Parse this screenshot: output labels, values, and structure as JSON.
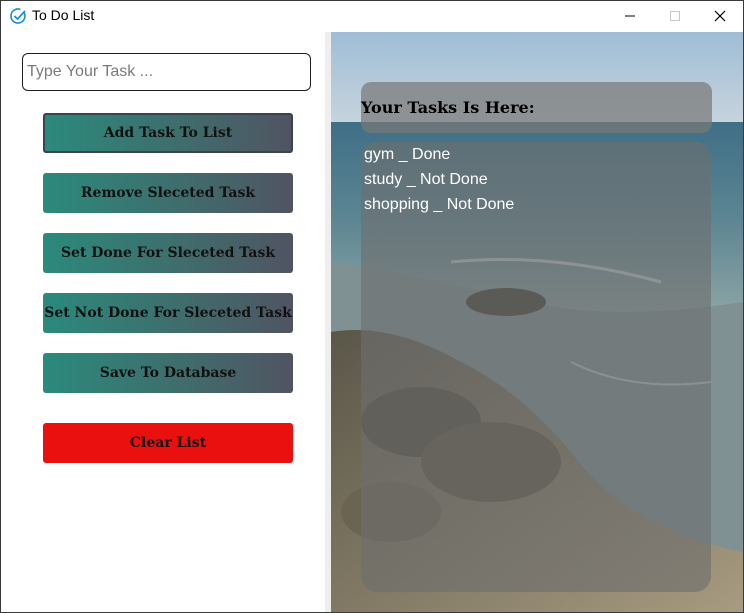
{
  "window": {
    "title": "To Do List"
  },
  "icons": {
    "app": "check-circle-icon",
    "minimize": "minimize-icon",
    "maximize": "maximize-icon",
    "close": "close-icon"
  },
  "input": {
    "value": "",
    "placeholder": "Type Your Task ..."
  },
  "buttons": {
    "add": "Add Task To List",
    "remove": "Remove Sleceted Task",
    "set_done": "Set Done For Sleceted Task",
    "set_not_done": "Set Not Done For Sleceted Task",
    "save": "Save To Database",
    "clear": "Clear List"
  },
  "tasks": {
    "header": "Your Tasks Is Here:",
    "items": [
      "gym _ Done",
      "study _ Not Done",
      "shopping _ Not Done"
    ]
  },
  "colors": {
    "accent_start": "#2b8a7c",
    "accent_end": "#505462",
    "danger": "#ea1010",
    "titlebar_icon": "#1a8fd6"
  }
}
